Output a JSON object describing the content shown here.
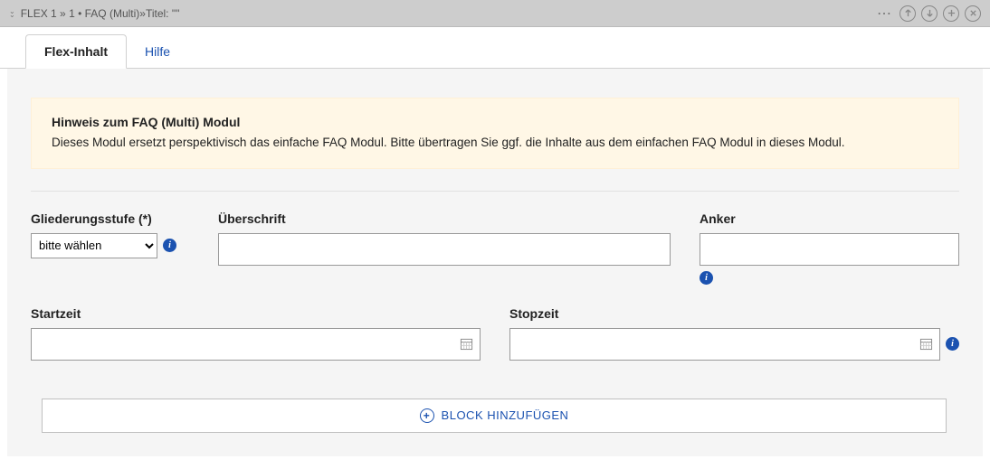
{
  "header": {
    "title": "FLEX 1 »  1 • FAQ (Multi)»Titel: \"\""
  },
  "tabs": [
    {
      "label": "Flex-Inhalt",
      "active": true
    },
    {
      "label": "Hilfe",
      "active": false
    }
  ],
  "info": {
    "title": "Hinweis zum FAQ (Multi) Modul",
    "text": "Dieses Modul ersetzt perspektivisch das einfache FAQ Modul. Bitte übertragen Sie ggf. die Inhalte aus dem einfachen FAQ Modul in dieses Modul."
  },
  "fields": {
    "gliederung": {
      "label": "Gliederungsstufe (*)",
      "selected": "bitte wählen"
    },
    "ueberschrift": {
      "label": "Überschrift",
      "value": ""
    },
    "anker": {
      "label": "Anker",
      "value": ""
    },
    "startzeit": {
      "label": "Startzeit",
      "value": ""
    },
    "stopzeit": {
      "label": "Stopzeit",
      "value": ""
    }
  },
  "addBlock": "BLOCK HINZUFÜGEN"
}
